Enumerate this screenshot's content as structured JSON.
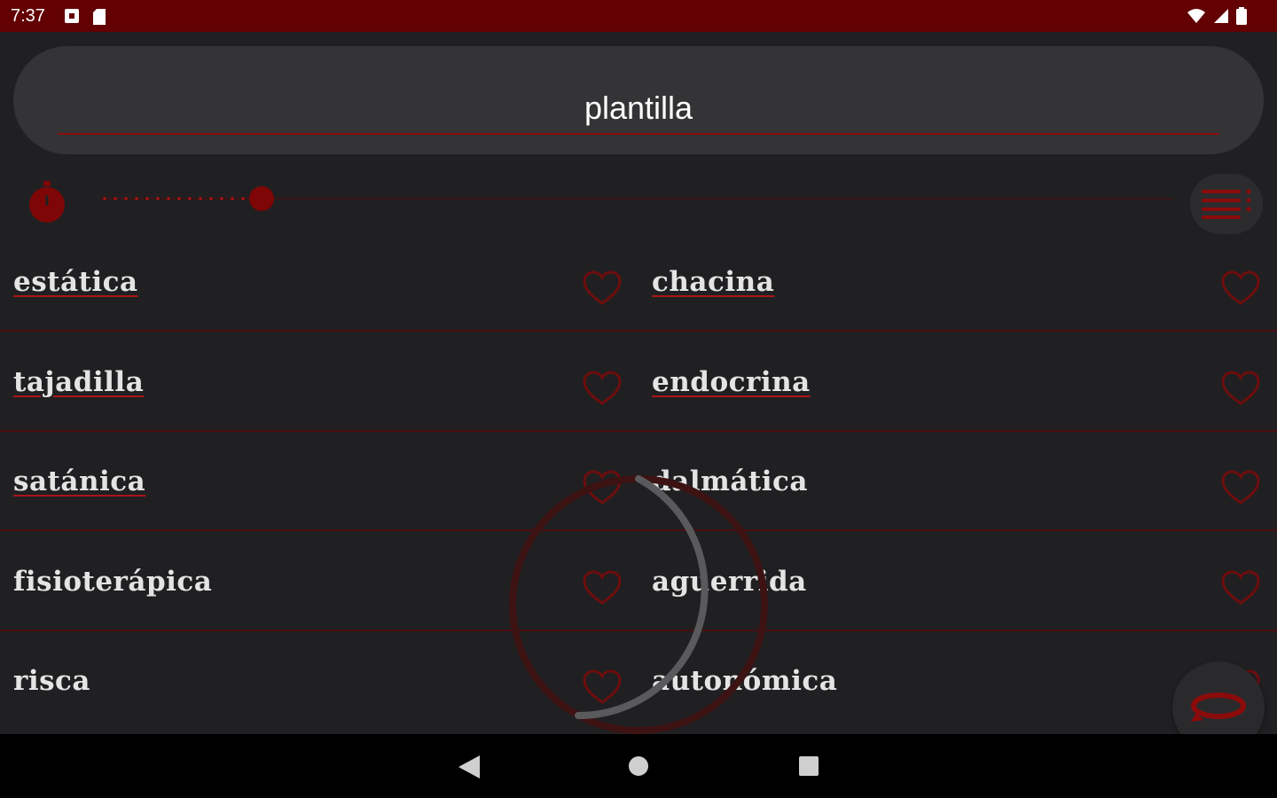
{
  "status_bar": {
    "time": "7:37",
    "left_icons": [
      "notification-square-icon",
      "sd-card-icon"
    ],
    "right_icons": [
      "wifi-icon",
      "signal-icon",
      "battery-icon"
    ]
  },
  "search": {
    "value": "plantilla",
    "placeholder": ""
  },
  "toolbar": {
    "stopwatch_icon": "stopwatch-icon",
    "slider_level": 0.14,
    "menu_icon": "list-menu-icon"
  },
  "words": [
    {
      "left": "estática",
      "left_linked": true,
      "right": "chacina",
      "right_linked": true
    },
    {
      "left": "tajadilla",
      "left_linked": true,
      "right": "endocrina",
      "right_linked": true
    },
    {
      "left": "satánica",
      "left_linked": true,
      "right": "dalmática",
      "right_linked": false
    },
    {
      "left": "fisioterápica",
      "left_linked": false,
      "right": "aguerrida",
      "right_linked": false
    },
    {
      "left": "risca",
      "left_linked": false,
      "right": "autonómica",
      "right_linked": false
    }
  ],
  "fab": {
    "icon": "refresh-icon"
  },
  "nav": {
    "back_icon": "back-icon",
    "home_icon": "home-icon",
    "recents_icon": "recents-icon"
  },
  "colors": {
    "accent": "#8b0b0b",
    "status_bar": "#620002",
    "background": "#202022",
    "search_background": "#343436",
    "heart_stroke": "#6e0d0d"
  }
}
